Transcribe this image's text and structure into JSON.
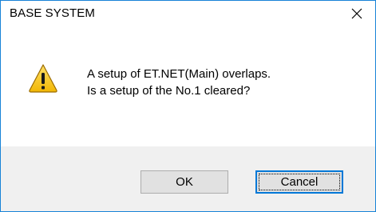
{
  "window": {
    "title": "BASE SYSTEM",
    "close_icon": "close-icon",
    "accent_color": "#1883d7"
  },
  "message": {
    "icon": "warning-icon",
    "line1": "A setup of ET.NET(Main) overlaps.",
    "line2": "Is a setup of the No.1 cleared?"
  },
  "buttons": {
    "ok_label": "OK",
    "cancel_label": "Cancel",
    "focused": "Cancel"
  }
}
